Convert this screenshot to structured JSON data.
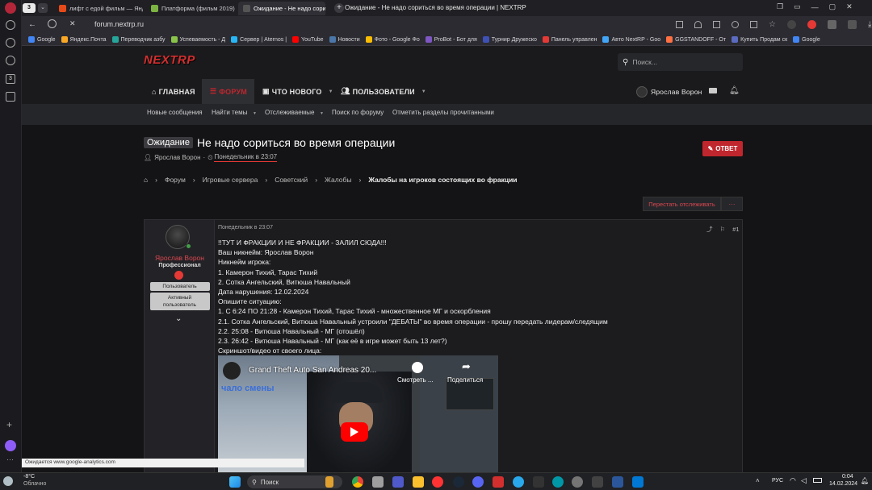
{
  "browser": {
    "tabs": [
      {
        "label": "лифт с едой фильм — Янде",
        "color": "#e64a19"
      },
      {
        "label": "Платформа (фильм 2019) —",
        "color": "#7cb342"
      },
      {
        "label": "Ожидание - Не надо сорит",
        "color": "#888888"
      }
    ],
    "window_title": "Ожидание - Не надо сориться во время операции | NEXTRP",
    "url": "forum.nextrp.ru",
    "tab_count": "3",
    "bookmarks": [
      {
        "label": "Google",
        "color": "#4285f4"
      },
      {
        "label": "Яндекс.Почта",
        "color": "#f9a825"
      },
      {
        "label": "Переводчик азбу",
        "color": "#26a69a"
      },
      {
        "label": "Успеваемость - Д",
        "color": "#8bc34a"
      },
      {
        "label": "Сервер | Aternos |",
        "color": "#29b6f6"
      },
      {
        "label": "YouTube",
        "color": "#ff0000"
      },
      {
        "label": "Новости",
        "color": "#4a76a8"
      },
      {
        "label": "Фото - Google Фо",
        "color": "#fbbc05"
      },
      {
        "label": "ProBot - Бот для",
        "color": "#7e57c2"
      },
      {
        "label": "Турнир Дружеско",
        "color": "#3f51b5"
      },
      {
        "label": "Панель управлен",
        "color": "#e53935"
      },
      {
        "label": "Авто NextRP - Goo",
        "color": "#42a5f5"
      },
      {
        "label": "GGSTANDOFF - От",
        "color": "#ff7043"
      },
      {
        "label": "Купить Продам ск",
        "color": "#5c6bc0"
      },
      {
        "label": "Google",
        "color": "#4285f4"
      }
    ],
    "status_text": "Ожидается www.google-analytics.com"
  },
  "site": {
    "logo": "NEXTRP",
    "search_placeholder": "Поиск...",
    "nav": {
      "home": "ГЛАВНАЯ",
      "forum": "ФОРУМ",
      "whats_new": "ЧТО НОВОГО",
      "users": "ПОЛЬЗОВАТЕЛИ",
      "username": "Ярослав Ворон"
    },
    "subnav": [
      "Новые сообщения",
      "Найти темы",
      "Отслеживаемые",
      "Поиск по форуму",
      "Отметить разделы прочитанными"
    ],
    "accent": "#c0262d"
  },
  "thread": {
    "status": "Ожидание",
    "title": "Не надо сориться во время операции",
    "author": "Ярослав Ворон",
    "date": "Понедельник в 23:07",
    "reply_button": "ОТВЕТ",
    "breadcrumbs": [
      "Форум",
      "Игровые сервера",
      "Советский",
      "Жалобы",
      "Жалобы на игроков состоящих во фракции"
    ],
    "unwatch_button": "Перестать отслеживать",
    "more_button": "···"
  },
  "post": {
    "user_name": "Ярослав Ворон",
    "user_title": "Профессионал",
    "banner1": "Пользователь",
    "banner2": "Активный пользователь",
    "timestamp": "Понедельник в 23:07",
    "number": "#1",
    "lines": [
      "!!ТУТ И ФРАКЦИИ И НЕ ФРАКЦИИ - ЗАЛИЛ СЮДА!!!",
      "Ваш никнейм: Ярослав Ворон",
      "Никнейм игрока:",
      "1. Камерон Тихий, Тарас Тихий",
      "2. Сотка Ангельский, Витюша Навальный",
      "Дата нарушения: 12.02.2024",
      "Опишите ситуацию:",
      "1. С 6:24 ПО 21:28 - Камерон Тихий, Тарас Тихий - множественное МГ и оскорбления",
      "2.1. Сотка Ангельский, Витюша Навальный устроили \"ДЕБАТЫ\" во время операции - прошу передать лидерам/следящим",
      "2.2. 25:08 - Витюша Навальный - МГ (отошёл)",
      "2.3. 26:42 - Витюша Навальный - МГ (как её в игре может быть 13 лет?)",
      "Скриншот/видео от своего лица:"
    ],
    "video": {
      "title": "Grand Theft Auto San Andreas 20...",
      "watch_later": "Смотреть ...",
      "share": "Поделиться",
      "overlay_text": "чало смены"
    }
  },
  "taskbar": {
    "temperature": "-8°C",
    "weather": "Облачно",
    "search_placeholder": "Поиск",
    "language": "РУС",
    "time": "0:04",
    "date": "14.02.2024"
  }
}
